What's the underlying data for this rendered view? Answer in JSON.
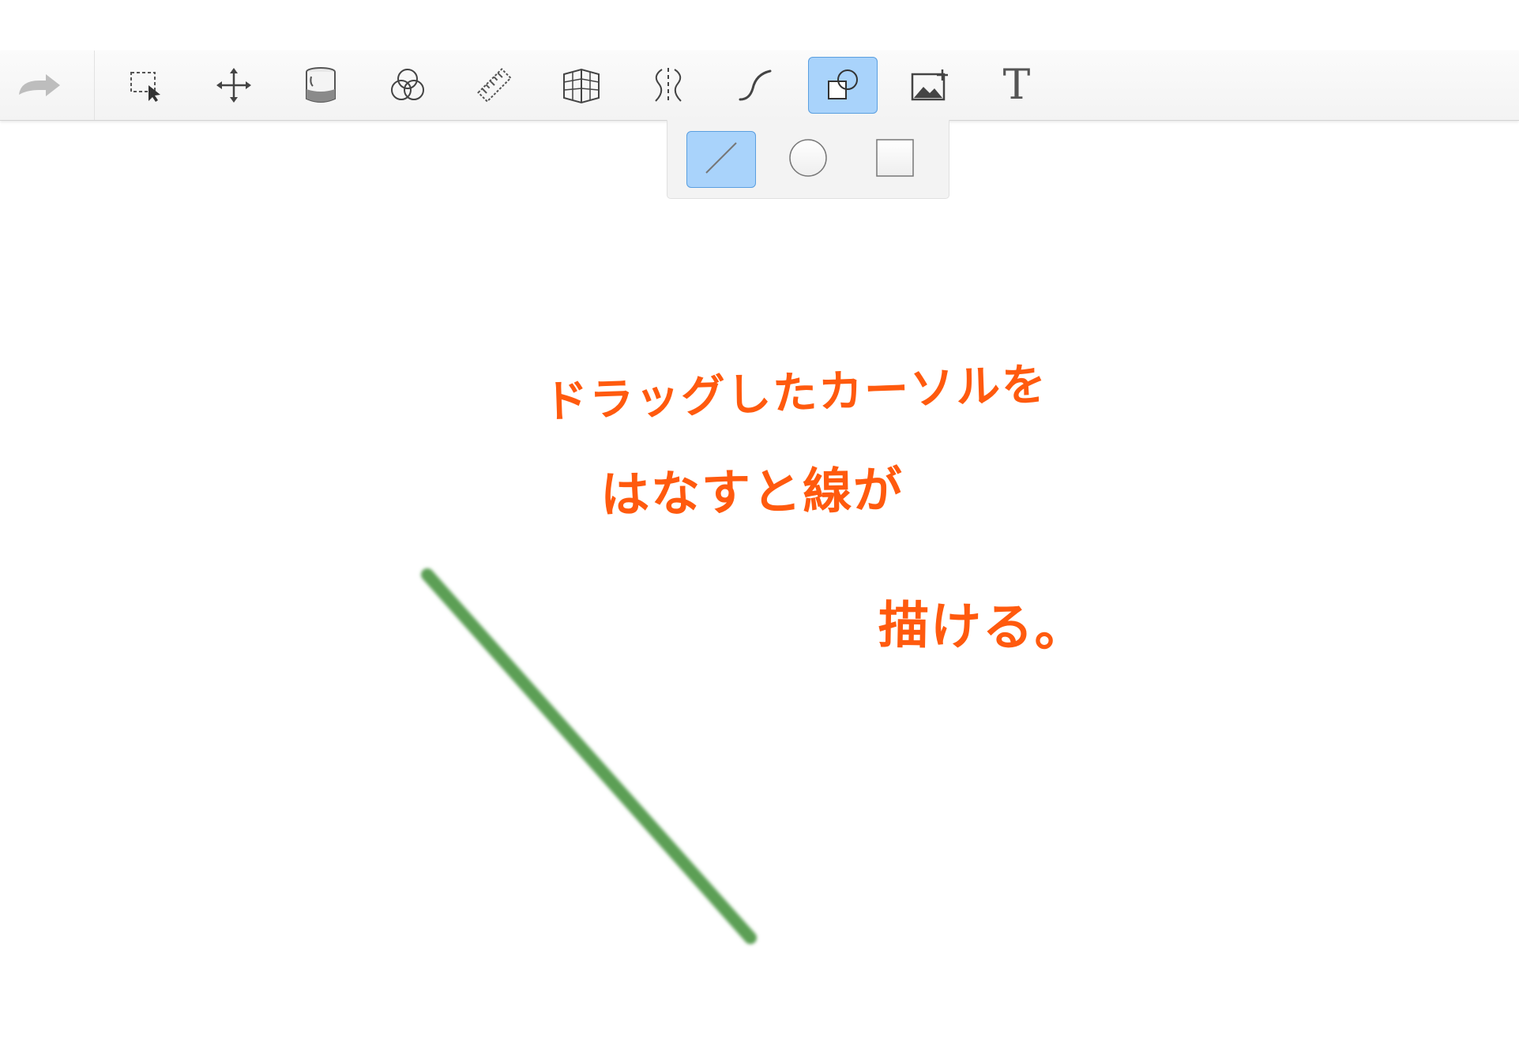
{
  "toolbar": {
    "tools": [
      {
        "id": "redo",
        "icon": "redo-arrow-icon",
        "active": false
      },
      {
        "id": "selection",
        "icon": "selection-icon",
        "active": false
      },
      {
        "id": "transform",
        "icon": "move-icon",
        "active": false
      },
      {
        "id": "fill",
        "icon": "paint-bucket-icon",
        "active": false
      },
      {
        "id": "blend",
        "icon": "color-circles-icon",
        "active": false
      },
      {
        "id": "ruler",
        "icon": "ruler-icon",
        "active": false
      },
      {
        "id": "perspective",
        "icon": "perspective-grid-icon",
        "active": false
      },
      {
        "id": "symmetry",
        "icon": "symmetry-icon",
        "active": false
      },
      {
        "id": "stroke",
        "icon": "curve-icon",
        "active": false
      },
      {
        "id": "shapes",
        "icon": "shapes-icon",
        "active": true
      },
      {
        "id": "image",
        "icon": "add-image-icon",
        "active": false
      },
      {
        "id": "text",
        "icon": "text-icon",
        "label": "T",
        "active": false
      }
    ],
    "accent_color": "#a9d3fb",
    "accent_border": "#5a9fe0"
  },
  "shape_options": [
    {
      "id": "line",
      "icon": "line-icon",
      "active": true
    },
    {
      "id": "ellipse",
      "icon": "circle-icon",
      "active": false
    },
    {
      "id": "rectangle",
      "icon": "square-icon",
      "active": false
    }
  ],
  "annotation": {
    "line1": "ドラッグしたカーソルを",
    "line2": "はなすと線が",
    "line3": "描ける。",
    "color": "#ff5a0e"
  },
  "canvas": {
    "stroke_color": "#5c9f55"
  }
}
